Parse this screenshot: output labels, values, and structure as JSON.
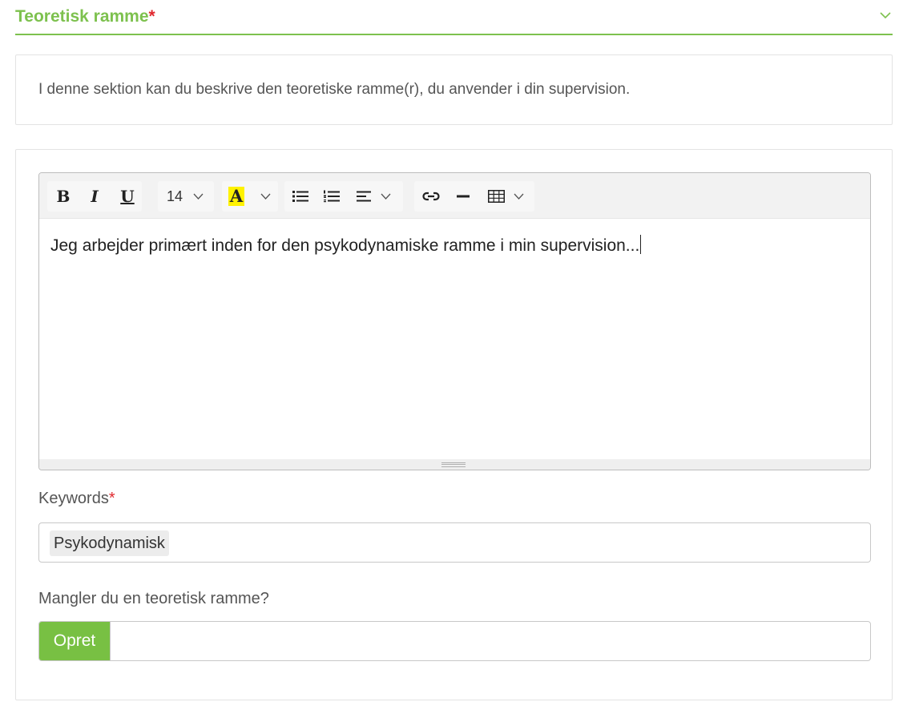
{
  "section": {
    "title": "Teoretisk ramme",
    "required_mark": "*",
    "collapse_icon": "chevron-down-icon",
    "accent_color": "#7dc14e"
  },
  "info": {
    "text": "I denne sektion kan du beskrive den teoretiske ramme(r), du anvender i din supervision."
  },
  "editor": {
    "toolbar": {
      "bold_label": "B",
      "italic_label": "I",
      "underline_label": "U",
      "font_size": "14",
      "highlight_label": "A",
      "highlight_color": "#fff200",
      "icons": [
        "bold-icon",
        "italic-icon",
        "underline-icon",
        "font-size-dropdown",
        "highlight-icon",
        "bullet-list-icon",
        "numbered-list-icon",
        "align-icon",
        "link-icon",
        "horizontal-rule-icon",
        "table-icon"
      ]
    },
    "content": "Jeg arbejder primært inden for den psykodynamiske ramme i min supervision..."
  },
  "keywords": {
    "label": "Keywords",
    "required_mark": "*",
    "tags": [
      "Psykodynamisk"
    ]
  },
  "missing_frame": {
    "label": "Mangler du en teoretisk ramme?",
    "button_label": "Opret",
    "button_color": "#78c043"
  }
}
